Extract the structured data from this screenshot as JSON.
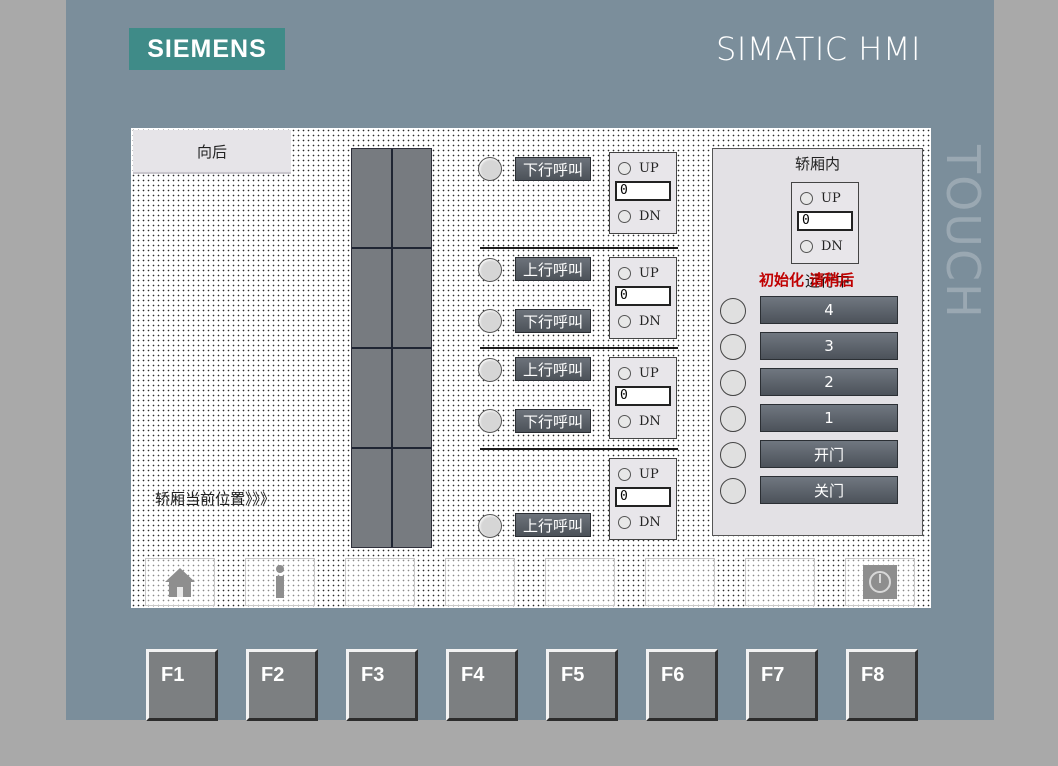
{
  "brand": {
    "logo": "SIEMENS",
    "product": "SIMATIC HMI",
    "touch": "TOUCH"
  },
  "screen": {
    "back_label": "向后",
    "car_position_label": "轿厢当前位置》》》",
    "floors": [
      {
        "calls": [
          "下行呼叫"
        ],
        "display": {
          "up": "UP",
          "value": "0",
          "dn": "DN"
        }
      },
      {
        "calls": [
          "上行呼叫",
          "下行呼叫"
        ],
        "display": {
          "up": "UP",
          "value": "0",
          "dn": "DN"
        }
      },
      {
        "calls": [
          "上行呼叫",
          "下行呼叫"
        ],
        "display": {
          "up": "UP",
          "value": "0",
          "dn": "DN"
        }
      },
      {
        "calls": [
          "上行呼叫"
        ],
        "display": {
          "up": "UP",
          "value": "0",
          "dn": "DN"
        }
      }
    ],
    "car_panel": {
      "title": "轿厢内",
      "display": {
        "up": "UP",
        "value": "0",
        "dn": "DN"
      },
      "status_red": "初始化   请稍后",
      "status_black": "运行中",
      "buttons": [
        "4",
        "3",
        "2",
        "1",
        "开门",
        "关门"
      ]
    }
  },
  "navbar": {
    "icons": [
      "home-icon",
      "info-icon",
      "power-icon"
    ]
  },
  "function_keys": [
    "F1",
    "F2",
    "F3",
    "F4",
    "F5",
    "F6",
    "F7",
    "F8"
  ],
  "colors": {
    "bezel": "#7b8e9b",
    "logo": "#3f8b88",
    "button": "#555b62",
    "status_red": "#c00000"
  }
}
